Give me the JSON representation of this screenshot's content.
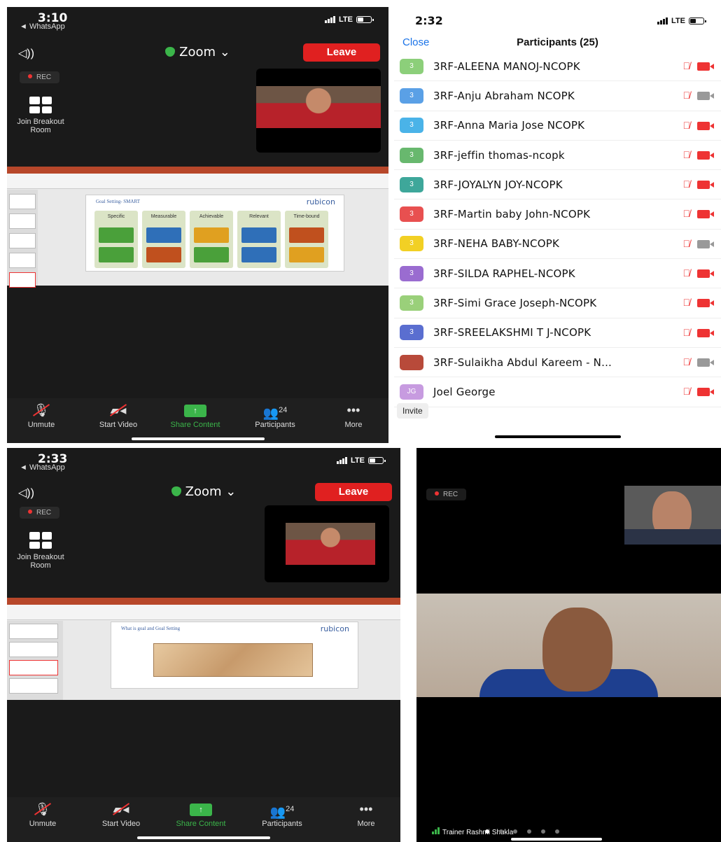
{
  "panel1": {
    "time": "3:10",
    "back_label": "◄ WhatsApp",
    "network": "LTE",
    "app_title": "Zoom ⌄",
    "leave_label": "Leave",
    "rec_label": "REC",
    "breakout_label": "Join Breakout Room",
    "slide": {
      "title": "Goal Setting- SMART",
      "logo": "rubicon",
      "columns": [
        "Specific",
        "Measurable",
        "Achievable",
        "Relevant",
        "Time-bound"
      ]
    }
  },
  "panel2": {
    "time": "2:32",
    "network": "LTE",
    "close_label": "Close",
    "title": "Participants (25)",
    "participants": [
      {
        "initial": "3",
        "name": "3RF-ALEENA MANOJ-NCOPK",
        "color": "#8ccf7a",
        "video_off": true
      },
      {
        "initial": "3",
        "name": "3RF-Anju Abraham NCOPK",
        "color": "#5aa0e6",
        "video_off": false
      },
      {
        "initial": "3",
        "name": "3RF-Anna Maria Jose NCOPK",
        "color": "#4ab3e8",
        "video_off": true
      },
      {
        "initial": "3",
        "name": "3RF-jeffin thomas-ncopk",
        "color": "#68b86e",
        "video_off": true
      },
      {
        "initial": "3",
        "name": "3RF-JOYALYN JOY-NCOPK",
        "color": "#3ea79a",
        "video_off": true
      },
      {
        "initial": "3",
        "name": "3RF-Martin baby John-NCOPK",
        "color": "#e85050",
        "video_off": true
      },
      {
        "initial": "3",
        "name": "3RF-NEHA BABY-NCOPK",
        "color": "#f2d024",
        "video_off": false
      },
      {
        "initial": "3",
        "name": "3RF-SILDA RAPHEL-NCOPK",
        "color": "#9a6cd0",
        "video_off": true
      },
      {
        "initial": "3",
        "name": "3RF-Simi Grace Joseph-NCOPK",
        "color": "#9ad07a",
        "video_off": true
      },
      {
        "initial": "3",
        "name": "3RF-SREELAKSHMI T J-NCOPK",
        "color": "#5a6ed0",
        "video_off": true
      },
      {
        "initial": "",
        "name": "3RF-Sulaikha Abdul Kareem - N...",
        "color": "#b84a3a",
        "video_off": false
      },
      {
        "initial": "JG",
        "name": "Joel George",
        "color": "#c79be0",
        "video_off": true
      }
    ],
    "invite_label": "Invite"
  },
  "panel3": {
    "time": "2:33",
    "back_label": "◄ WhatsApp",
    "network": "LTE",
    "app_title": "Zoom ⌄",
    "leave_label": "Leave",
    "rec_label": "REC",
    "breakout_label": "Join Breakout Room",
    "slide": {
      "title": "What is goal and Goal Setting",
      "logo": "rubicon"
    }
  },
  "toolbar": {
    "unmute": "Unmute",
    "start_video": "Start Video",
    "share": "Share Content",
    "participants": "Participants",
    "participant_count": "24",
    "more": "More"
  },
  "panel4": {
    "rec_label": "REC",
    "trainer_label": "Trainer Rashmi Shukla"
  },
  "colors": {
    "leave": "#e02020",
    "share": "#3bb54a",
    "link": "#1a73e8",
    "muted": "#e33333"
  }
}
